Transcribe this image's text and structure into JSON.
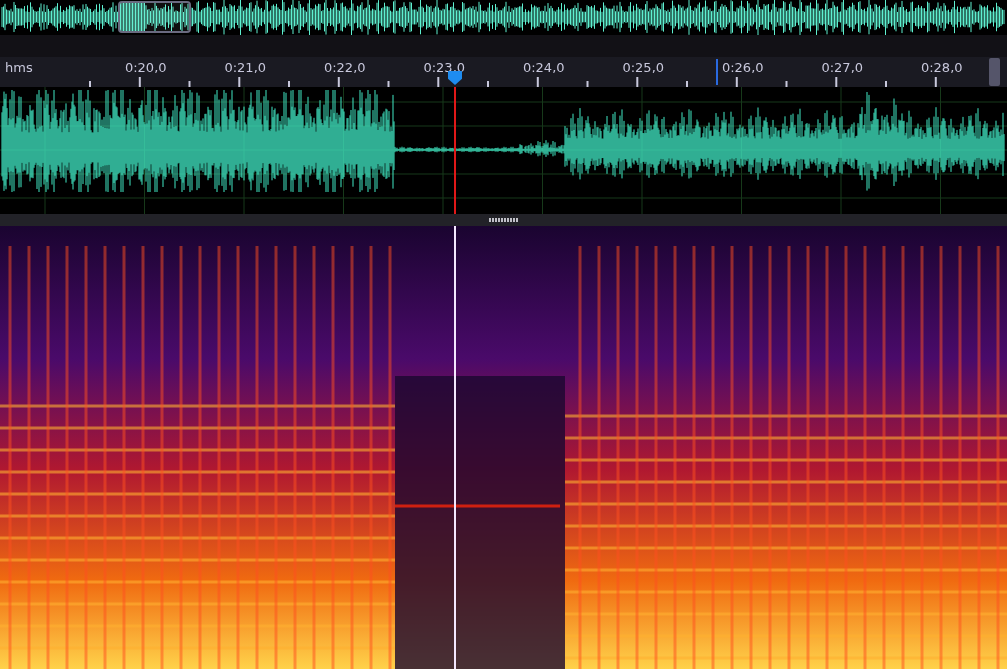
{
  "ruler": {
    "unit": "hms",
    "labels": [
      "0:20,0",
      "0:21,0",
      "0:22,0",
      "0:23,0",
      "0:24,0",
      "0:25,0",
      "0:26,0",
      "0:27,0",
      "0:28,0"
    ]
  }
}
